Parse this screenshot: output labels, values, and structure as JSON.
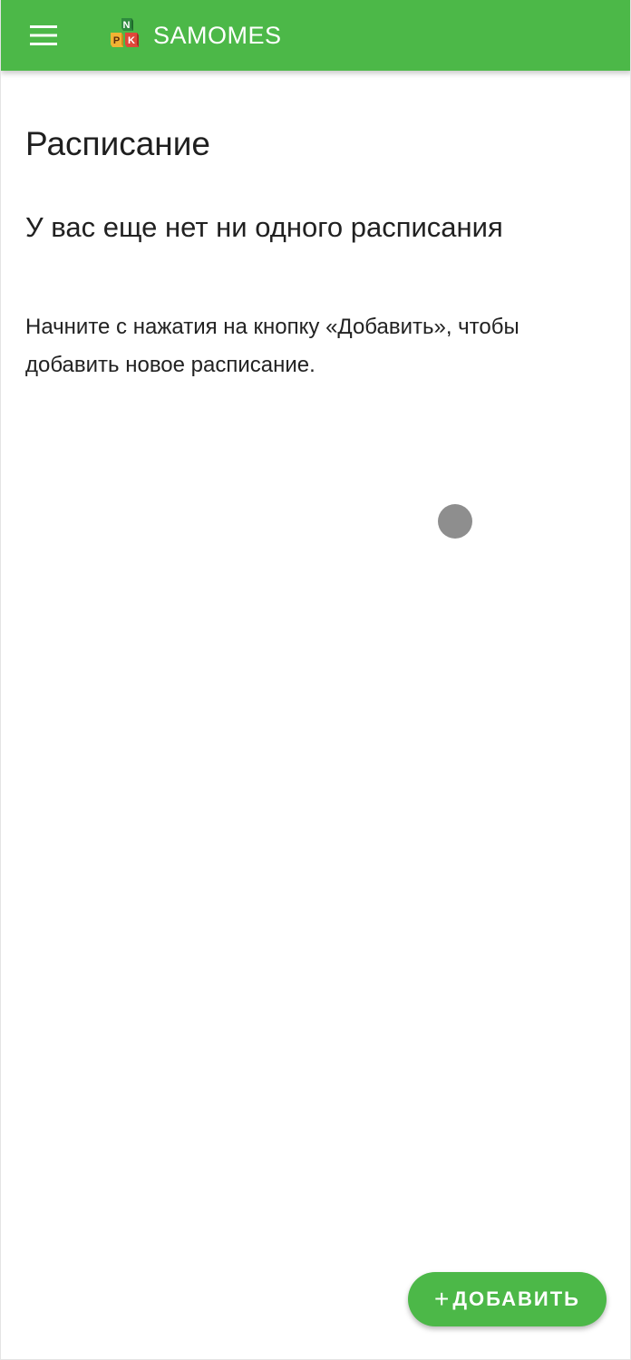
{
  "appbar": {
    "brand": "SAMOMES",
    "menu_icon": "hamburger-menu-icon",
    "logo": {
      "letters": [
        "N",
        "P",
        "K"
      ],
      "colors": [
        "#2e8b3e",
        "#f2b233",
        "#e0473a"
      ]
    },
    "color": "#4cb848"
  },
  "page": {
    "title": "Расписание",
    "empty_heading": "У вас еще нет ни одного расписания",
    "empty_description": "Начните с нажатия на кнопку «Добавить», чтобы добавить новое расписание."
  },
  "fab": {
    "icon": "plus-icon",
    "plus": "+",
    "label": "ДОБАВИТЬ"
  }
}
